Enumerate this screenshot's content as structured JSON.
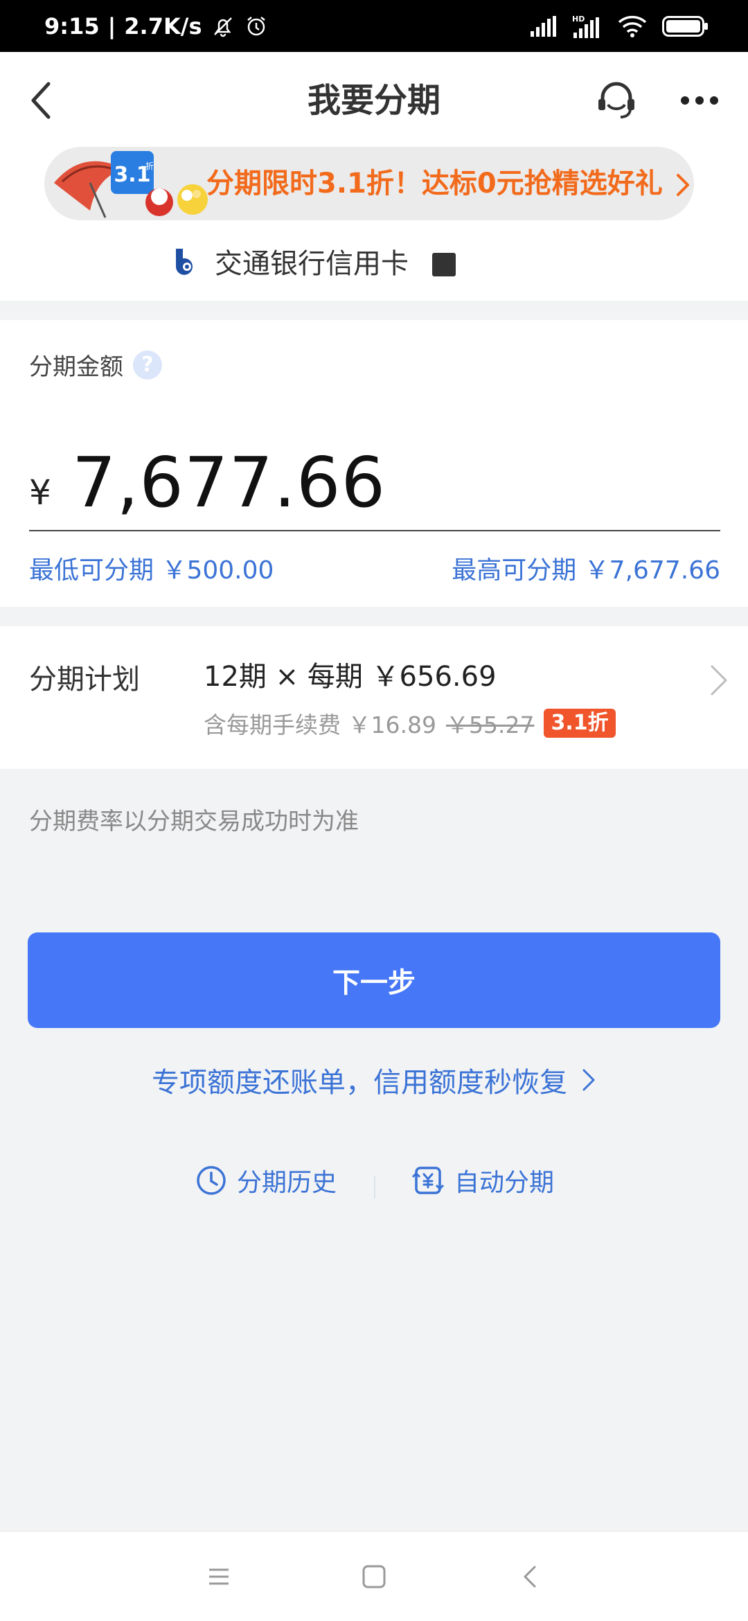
{
  "status_bar": {
    "time": "9:15",
    "speed": "2.7K/s",
    "network_tag": "HD"
  },
  "header": {
    "title": "我要分期"
  },
  "promo": {
    "badge_text": "3.1",
    "badge_sub": "折",
    "text": "分期限时3.1折！达标0元抢精选好礼"
  },
  "card": {
    "bank_name": "交通银行信用卡"
  },
  "amount": {
    "label": "分期金额",
    "help": "?",
    "currency": "¥",
    "value": "7,677.66",
    "min_limit": "最低可分期 ￥500.00",
    "max_limit": "最高可分期 ￥7,677.66"
  },
  "plan": {
    "label": "分期计划",
    "main": "12期 × 每期 ￥656.69",
    "fee_prefix": "含每期手续费 ￥16.89",
    "fee_original": "￥55.27",
    "discount": "3.1折"
  },
  "rate_note": "分期费率以分期交易成功时为准",
  "next_button": "下一步",
  "special_link": "专项额度还账单，信用额度秒恢复",
  "bottom_links": {
    "history": "分期历史",
    "auto": "自动分期"
  },
  "colors": {
    "primary": "#4677f7",
    "link": "#3b73d6",
    "promo_orange": "#f26a1b",
    "discount_red": "#f0552c"
  }
}
